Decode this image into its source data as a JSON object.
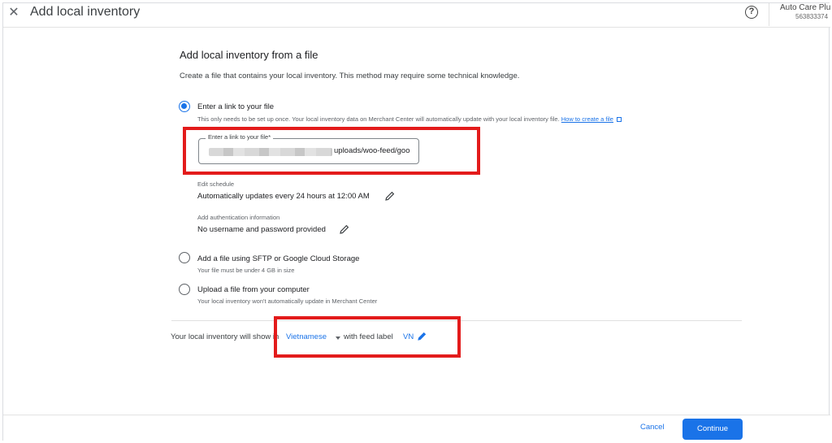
{
  "header": {
    "title": "Add local inventory",
    "account_name": "Auto Care Plu",
    "account_id": "563833374"
  },
  "main": {
    "heading": "Add local inventory from a file",
    "description": "Create a file that contains your local inventory. This method may require some technical knowledge.",
    "options": [
      {
        "label": "Enter a link to your file",
        "selected": true,
        "sub": "This only needs to be set up once. Your local inventory data on Merchant Center will automatically update with your local inventory file.",
        "link": "How to create a file"
      },
      {
        "label": "Add a file using SFTP or Google Cloud Storage",
        "selected": false,
        "sub": "Your file must be under 4 GB in size"
      },
      {
        "label": "Upload a file from your computer",
        "selected": false,
        "sub": "Your local inventory won't automatically update in Merchant Center"
      }
    ],
    "link_field": {
      "label": "Enter a link to your file*",
      "value": "uploads/woo-feed/goo"
    },
    "schedule": {
      "label": "Edit schedule",
      "value": "Automatically updates every 24 hours at 12:00 AM"
    },
    "auth": {
      "label": "Add authentication information",
      "value": "No username and password provided"
    },
    "inventory_line": {
      "prefix": "Your local inventory will show in",
      "language": "Vietnamese",
      "middle": "with feed label",
      "feed_label": "VN"
    }
  },
  "footer": {
    "cancel_label": "Cancel",
    "continue_label": "Continue"
  },
  "colors": {
    "accent": "#1a73e8",
    "highlight": "#e31b1b"
  }
}
